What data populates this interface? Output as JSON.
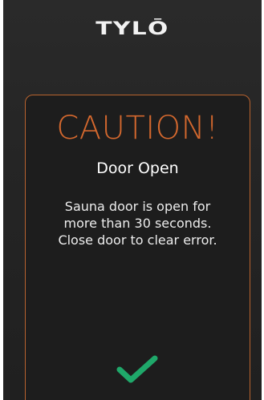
{
  "brand": {
    "logo_text": "TYLŌ"
  },
  "dialog": {
    "title": "CAUTION!",
    "subtitle": "Door Open",
    "message_lines": [
      "Sauna door is open for",
      "more than 30 seconds.",
      "Close door to clear error."
    ],
    "confirm_icon": "checkmark-icon"
  },
  "colors": {
    "accent": "#d4682e",
    "border": "#b8632f",
    "confirm": "#1fa86a",
    "background": "#252525"
  }
}
